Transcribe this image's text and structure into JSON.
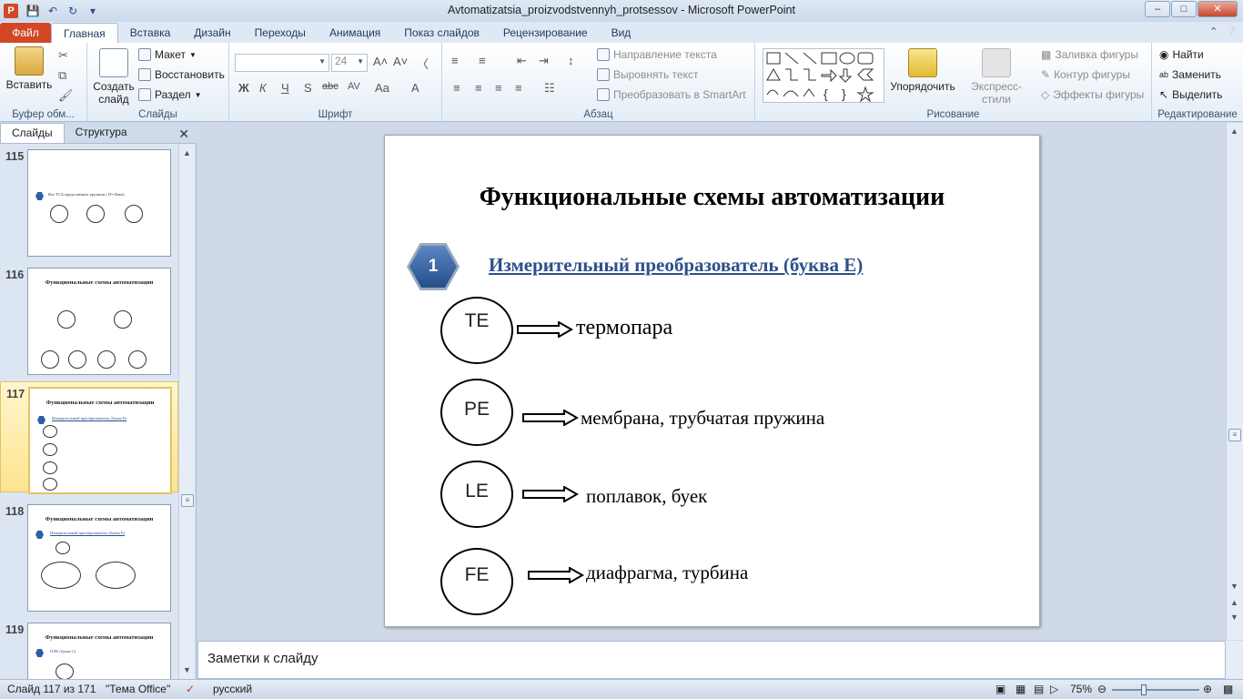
{
  "app": {
    "title": "Avtomatizatsia_proizvodstvennyh_protsessov  -  Microsoft PowerPoint",
    "icon_label": "P"
  },
  "window_controls": {
    "minimize": "–",
    "maximize": "□",
    "close": "✕"
  },
  "ribbon_tabs": {
    "file": "Файл",
    "items": [
      "Главная",
      "Вставка",
      "Дизайн",
      "Переходы",
      "Анимация",
      "Показ слайдов",
      "Рецензирование",
      "Вид"
    ],
    "active": "Главная"
  },
  "ribbon": {
    "clipboard": {
      "label": "Буфер обм...",
      "paste": "Вставить"
    },
    "slides": {
      "label": "Слайды",
      "new_slide": "Создать слайд",
      "layout": "Макет",
      "reset": "Восстановить",
      "section": "Раздел"
    },
    "font": {
      "label": "Шрифт",
      "font_name": "",
      "font_size": "24",
      "bold": "Ж",
      "italic": "К",
      "underline": "Ч",
      "shadow": "S",
      "strike": "abc",
      "spacing": "AV",
      "case": "Aa"
    },
    "paragraph": {
      "label": "Абзац",
      "text_direction": "Направление текста",
      "align_text": "Выровнять текст",
      "convert_smartart": "Преобразовать в SmartArt"
    },
    "drawing": {
      "label": "Рисование",
      "arrange": "Упорядочить",
      "quick_styles": "Экспресс-стили",
      "shape_fill": "Заливка фигуры",
      "shape_outline": "Контур фигуры",
      "shape_effects": "Эффекты фигуры"
    },
    "editing": {
      "label": "Редактирование",
      "find": "Найти",
      "replace": "Заменить",
      "select": "Выделить"
    }
  },
  "left_panel": {
    "tabs": [
      "Слайды",
      "Структура"
    ],
    "active_tab": "Слайды",
    "thumbnails": [
      {
        "num": "115",
        "title": "",
        "subtitle": "Все ТСА представляют кружком ( D=10мм)"
      },
      {
        "num": "116",
        "title": "Функциональные схемы автоматизации",
        "subtitle": ""
      },
      {
        "num": "117",
        "title": "Функциональные схемы автоматизации",
        "subtitle": "Измерительный преобразователь (буква Е)",
        "selected": true
      },
      {
        "num": "118",
        "title": "Функциональные схемы автоматизации",
        "subtitle": "Измерительный преобразователь (буква Е)"
      },
      {
        "num": "119",
        "title": "Функциональные схемы автоматизации",
        "subtitle": "ПЛК (буква С)"
      }
    ]
  },
  "slide": {
    "title": "Функциональные  схемы автоматизации",
    "badge_number": "1",
    "subheading": "Измерительный преобразователь (буква Е)",
    "items": [
      {
        "code": "TE",
        "description": "термопара"
      },
      {
        "code": "PE",
        "description": "мембрана, трубчатая пружина"
      },
      {
        "code": "LE",
        "description": "поплавок, буек"
      },
      {
        "code": "FE",
        "description": "диафрагма, турбина"
      }
    ]
  },
  "notes": {
    "placeholder": "Заметки к слайду"
  },
  "status_bar": {
    "slide_info": "Слайд 117 из 171",
    "theme": "\"Тема Office\"",
    "language": "русский",
    "zoom": "75%"
  }
}
